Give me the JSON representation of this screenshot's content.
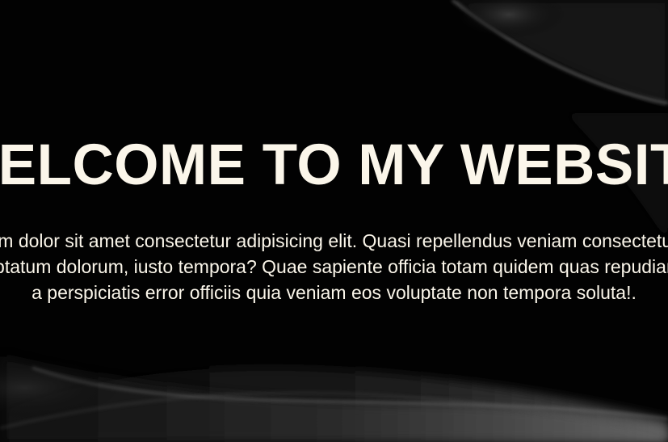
{
  "hero": {
    "title": "WELCOME TO MY WEBSITE",
    "paragraph_lines": [
      "Lorem ipsum dolor sit amet consectetur adipisicing elit. Quasi repellendus veniam consectetur ipsum totam, accusamus",
      "voluptatum dolorum, iusto tempora? Quae sapiente officia totam quidem quas repudiandae",
      "a perspiciatis error officiis quia veniam eos voluptate non tempora soluta!."
    ]
  },
  "colors": {
    "background": "#000000",
    "text": "#fbf6ea"
  }
}
